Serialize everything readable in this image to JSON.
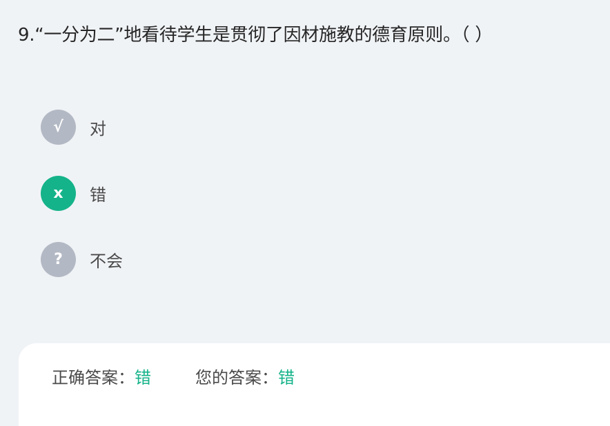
{
  "question": {
    "text": "9.“一分为二”地看待学生是贯彻了因材施教的德育原则。（   ）"
  },
  "options": [
    {
      "symbol": "√",
      "label": "对",
      "selected": false
    },
    {
      "symbol": "x",
      "label": "错",
      "selected": true
    },
    {
      "symbol": "?",
      "label": "不会",
      "selected": false
    }
  ],
  "answer": {
    "correct_label": "正确答案：",
    "correct_value": "错",
    "yours_label": "您的答案：",
    "yours_value": "错"
  },
  "colors": {
    "background": "#f0f3f6",
    "badge_default": "#b3b9c4",
    "badge_selected": "#15b38a",
    "answer_highlight": "#15b38a"
  }
}
